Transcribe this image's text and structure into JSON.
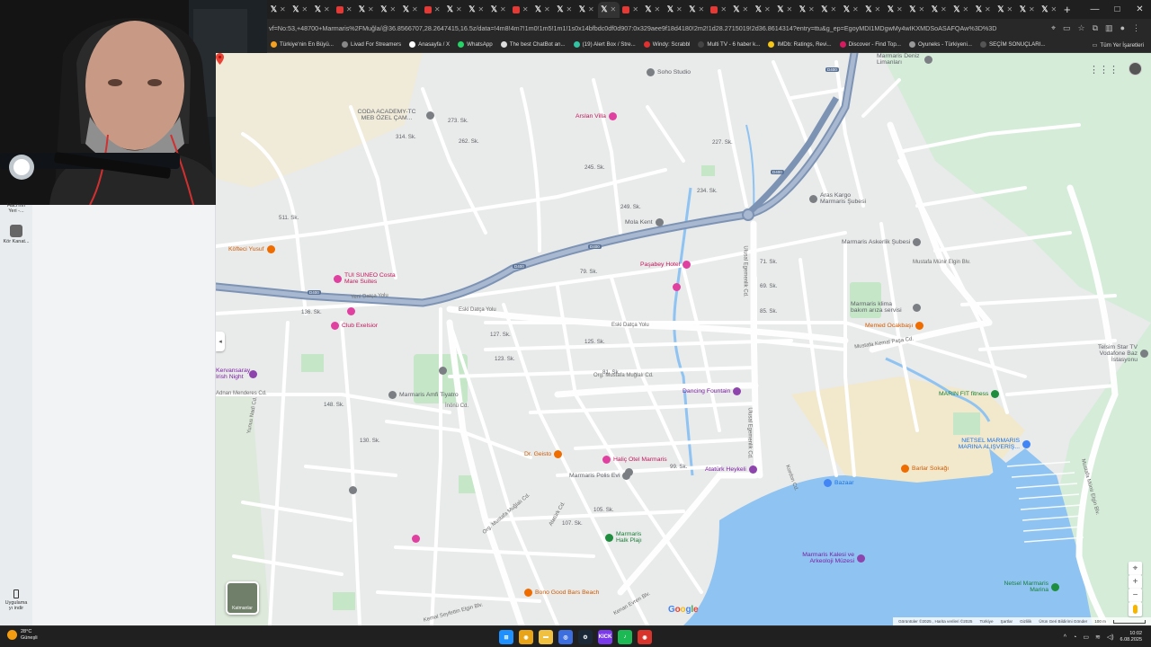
{
  "browser": {
    "tab_count": 36,
    "url": "vf=No:53,+48700+Marmaris%2FMuğla/@36.8566707,28.2647415,16.5z/data=!4m8!4m7!1m0!1m5!1m1!1s0x14bfbdc0df0d907:0x329aee9f18d4180!2m2!1d28.2715019!2d36.8614314?entry=ttu&g_ep=EgoyMDI1MDgwMy4wIKXMDSoASAFQAw%3D%3D",
    "window_controls": [
      "—",
      "□",
      "✕"
    ]
  },
  "bookmarks": [
    {
      "label": "Türkiye'nin En Büyü...",
      "color": "#f4a020"
    },
    {
      "label": "Livad For Streamers",
      "color": "#888888"
    },
    {
      "label": "Anasayfa / X",
      "color": "#ffffff"
    },
    {
      "label": "WhatsApp",
      "color": "#25d366"
    },
    {
      "label": "The best ChatBot an...",
      "color": "#dddddd"
    },
    {
      "label": "(19) Alert Box / Stre...",
      "color": "#31c3a2"
    },
    {
      "label": "Windy: Scrabbl",
      "color": "#e03030"
    },
    {
      "label": "Multi TV - 6 haber k...",
      "color": "#444444"
    },
    {
      "label": "IMDb: Ratings, Revi...",
      "color": "#f5c518"
    },
    {
      "label": "Discover - Find Top...",
      "color": "#d81b60"
    },
    {
      "label": "Oyuneks - Türkiyeni...",
      "color": "#999999"
    },
    {
      "label": "SEÇİM SONUÇLARI...",
      "color": "#555555"
    }
  ],
  "bookmarks_folder": "Tüm Yer İşaretleri",
  "desktop": {
    "icon1": "Hacı'nın Yeri -...",
    "icon2": "Kör Kanat...",
    "icon3": "Uygulama yı indir"
  },
  "map": {
    "labels": {
      "soho": "Soho Studio",
      "coda": "CODA ACADEMY-TC MEB ÖZEL ÇAM...",
      "arslan": "Arslan Villa",
      "aras": "Aras Kargo Marmaris Şubesi",
      "mola": "Mola Kent",
      "askerlik": "Marmaris Askerlik Şubesi",
      "koftec": "Köfteci Yusuf",
      "tui": "TUI SUNEO Costa Mare Suites",
      "pasabey": "Paşabey Hotel",
      "klima": "Marmaris klima bakım arıza servisi",
      "memed": "Memed Ocakbaşı",
      "exelsior": "Club Exelsior",
      "telsim": "Telsim Star TV Vodafone Baz İstasyonu",
      "amfi": "Marmaris Amfi Tiyatro",
      "dancing": "Dancing Fountain",
      "marin_fitness": "MARIN FIT fitness",
      "netsel": "NETSEL MARMARIS MARINA ALIŞVERİŞ...",
      "arvansaray": "Kervansaray Irish Night",
      "geisto": "Dr. Geisto",
      "halic": "Haliç Otel Marmaris",
      "polis": "Marmaris Polis Evi",
      "ataturk": "Atatürk Heykeli",
      "bazaar": "Bazaar",
      "barlar": "Barlar Sokağı",
      "halk": "Marmaris Halk Plajı",
      "kalesi": "Marmaris Kalesi ve Arkeoloji Müzesi",
      "netsel_marina": "Netsel Marmaris Marina",
      "bono": "Bono Good Bars Beach",
      "liman": "Marmaris Deniz Limanları"
    },
    "roads": {
      "yeni_datca": "Yeni Datça Yolu",
      "eski_datca": "Eski Datça Yolu",
      "eski_datca2": "Eski Datça Yolu",
      "ulusal": "Ulusal Egemenlik Cd.",
      "ulusal2": "Ulusal Egemenlik Cd.",
      "inonu": "İnönü Cd.",
      "ataturk_cd": "Atatürk Cd.",
      "mustafa_muglali": "Org. Mustafa Muğlalı Cd.",
      "mustafa_muglali2": "Org. Mustafa Muğlalı Cd.",
      "mustafa_kemal": "Mustafa Kemal Paşa Cd.",
      "mustafa_munir": "Mustafa Münir Elgin Blv.",
      "mustafa_munir2": "Mustafa Münir Elgin Blv.",
      "kemal_seyfettin": "Kemal Seyfettin Elgin Blv.",
      "menderes": "Adnan Menderes Cd.",
      "kordon": "Kordon Cd.",
      "yunus_nadi": "Yunus Nadi Cd.",
      "kenan_evren": "Kenan Evren Blv.",
      "hwy": "D400",
      "sk": [
        "273. Sk.",
        "262. Sk.",
        "227. Sk.",
        "245. Sk.",
        "249. Sk.",
        "234. Sk.",
        "71. Sk.",
        "69. Sk.",
        "85. Sk.",
        "127. Sk.",
        "123. Sk.",
        "148. Sk.",
        "130. Sk.",
        "105. Sk.",
        "99. Sk.",
        "107. Sk.",
        "136. Sk.",
        "125. Sk.",
        "81. Sk.",
        "79. Sk.",
        "511. Sk.",
        "314. Sk."
      ]
    },
    "layer_button": "Katmanlar",
    "google": "Google",
    "footer": [
      "Görüntüler ©2025 , Harita verileri ©2025",
      "Türkiye",
      "Şartlar",
      "Gizlilik",
      "Ürün Geri Bildirimi Gönder",
      "100 m"
    ]
  },
  "taskbar": {
    "temp": "28°C",
    "weather": "Güneşli",
    "time": "10:02",
    "date": "6.08.2025",
    "apps": [
      {
        "name": "start",
        "color": "#1e90ff",
        "text": "⊞"
      },
      {
        "name": "chrome",
        "color": "#e8a317",
        "text": "◉"
      },
      {
        "name": "files",
        "color": "#f0c040",
        "text": "▬"
      },
      {
        "name": "obs",
        "color": "#3d6ee0",
        "text": "◎"
      },
      {
        "name": "steam",
        "color": "#1b2838",
        "text": "⚙"
      },
      {
        "name": "kick",
        "color": "#7c3aed",
        "text": "KICK"
      },
      {
        "name": "spotify",
        "color": "#1db954",
        "text": "♪"
      },
      {
        "name": "chrome2",
        "color": "#d9342b",
        "text": "◉"
      }
    ]
  }
}
